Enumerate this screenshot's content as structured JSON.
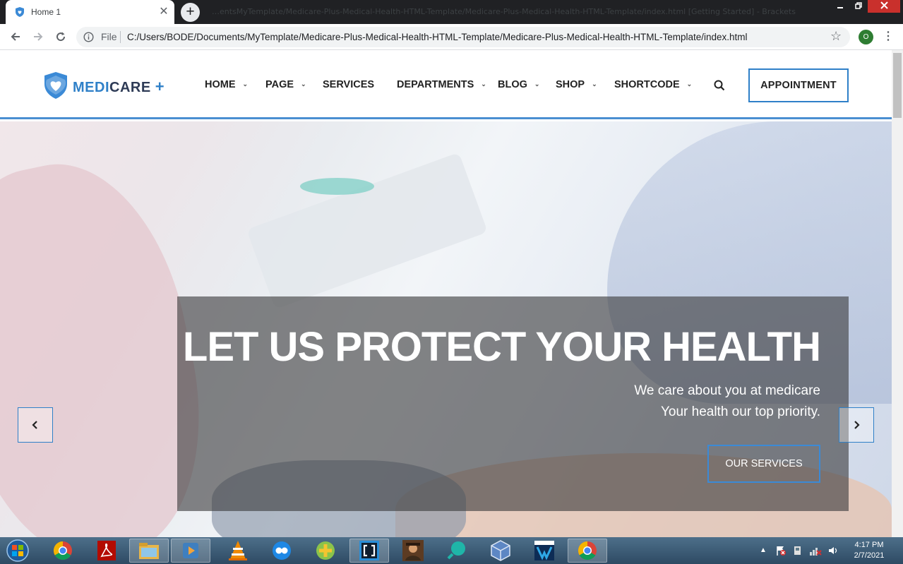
{
  "browser": {
    "tab_title": "Home 1",
    "title_ghost_text": "…entsMyTemplate/Medicare-Plus-Medical-Health-HTML-Template/Medicare-Plus-Medical-Health-HTML-Template/index.html [Getting Started] - Brackets",
    "new_tab_glyph": "+",
    "address_scheme_label": "File",
    "address_url": "C:/Users/BODE/Documents/MyTemplate/Medicare-Plus-Medical-Health-HTML-Template/Medicare-Plus-Medical-Health-HTML-Template/index.html",
    "profile_initial": "O"
  },
  "site": {
    "logo": {
      "part_a": "MEDI",
      "part_b": "CARE",
      "part_c": "+"
    },
    "nav": [
      {
        "label": "HOME",
        "has_dropdown": true
      },
      {
        "label": "PAGE",
        "has_dropdown": true
      },
      {
        "label": "SERVICES",
        "has_dropdown": false
      },
      {
        "label": "DEPARTMENTS",
        "has_dropdown": true
      },
      {
        "label": "BLOG",
        "has_dropdown": true
      },
      {
        "label": "SHOP",
        "has_dropdown": true
      },
      {
        "label": "SHORTCODE",
        "has_dropdown": true
      }
    ],
    "appointment_label": "APPOINTMENT",
    "hero": {
      "headline": "LET US PROTECT YOUR HEALTH",
      "subline_1": "We care about you at medicare",
      "subline_2": "Your health our top priority.",
      "cta_label": "OUR SERVICES"
    }
  },
  "taskbar": {
    "apps": [
      "chrome-icon",
      "acrobat-icon",
      "file-explorer-icon",
      "media-player-icon",
      "vlc-icon",
      "messaging-icon",
      "add-app-icon",
      "brackets-icon",
      "user-photo-icon",
      "search-app-icon",
      "cube-app-icon",
      "video-editor-icon",
      "chrome-icon"
    ],
    "time": "4:17 PM",
    "date": "2/7/2021"
  },
  "colors": {
    "accent": "#2f80c8",
    "navy": "#2e3b56"
  }
}
